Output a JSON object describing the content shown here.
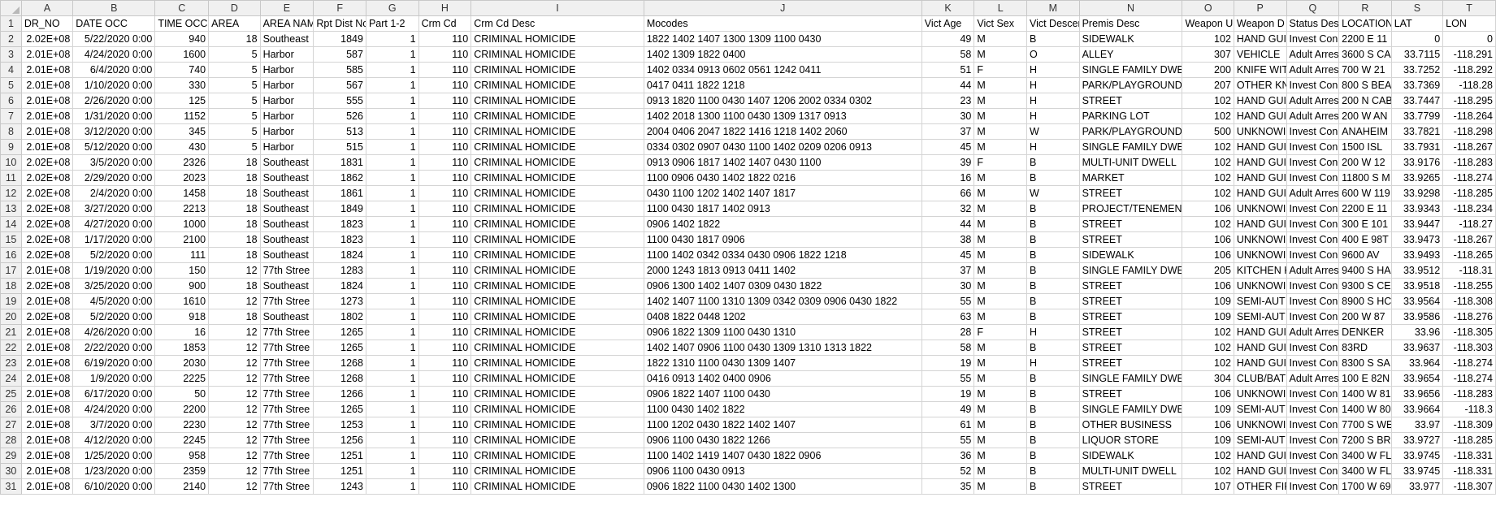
{
  "sheet": {
    "column_letters": [
      "A",
      "B",
      "C",
      "D",
      "E",
      "F",
      "G",
      "H",
      "I",
      "J",
      "K",
      "L",
      "M",
      "N",
      "O",
      "P",
      "Q",
      "R",
      "S",
      "T"
    ],
    "headers": [
      "DR_NO",
      "DATE OCC",
      "TIME OCC",
      "AREA",
      "AREA NAM",
      "Rpt Dist No",
      "Part 1-2",
      "Crm Cd",
      "Crm Cd Desc",
      "Mocodes",
      "Vict Age",
      "Vict Sex",
      "Vict Descent",
      "Premis Desc",
      "Weapon U",
      "Weapon D",
      "Status Des",
      "LOCATION",
      "LAT",
      "LON"
    ],
    "header_row_number": "1",
    "rows": [
      {
        "num": "2",
        "cells": [
          "2.02E+08",
          "5/22/2020 0:00",
          "940",
          "18",
          "Southeast",
          "1849",
          "1",
          "110",
          "CRIMINAL HOMICIDE",
          "1822 1402 1407 1300 1309 1100 0430",
          "49",
          "M",
          "B",
          "SIDEWALK",
          "102",
          "HAND GUI",
          "Invest Con",
          "2200 E 11",
          "0",
          "0"
        ]
      },
      {
        "num": "3",
        "cells": [
          "2.01E+08",
          "4/24/2020 0:00",
          "1600",
          "5",
          "Harbor",
          "587",
          "1",
          "110",
          "CRIMINAL HOMICIDE",
          "1402 1309 1822 0400",
          "58",
          "M",
          "O",
          "ALLEY",
          "307",
          "VEHICLE",
          "Adult Arres",
          "3600 S CA",
          "33.7115",
          "-118.291"
        ]
      },
      {
        "num": "4",
        "cells": [
          "2.01E+08",
          "6/4/2020 0:00",
          "740",
          "5",
          "Harbor",
          "585",
          "1",
          "110",
          "CRIMINAL HOMICIDE",
          "1402 0334 0913 0602 0561 1242 0411",
          "51",
          "F",
          "H",
          "SINGLE FAMILY DWE",
          "200",
          "KNIFE WIT",
          "Adult Arres",
          "700 W 21",
          "33.7252",
          "-118.292"
        ]
      },
      {
        "num": "5",
        "cells": [
          "2.01E+08",
          "1/10/2020 0:00",
          "330",
          "5",
          "Harbor",
          "567",
          "1",
          "110",
          "CRIMINAL HOMICIDE",
          "0417 0411 1822 1218",
          "44",
          "M",
          "H",
          "PARK/PLAYGROUND",
          "207",
          "OTHER KN",
          "Invest Con",
          "800 S BEA",
          "33.7369",
          "-118.28"
        ]
      },
      {
        "num": "6",
        "cells": [
          "2.01E+08",
          "2/26/2020 0:00",
          "125",
          "5",
          "Harbor",
          "555",
          "1",
          "110",
          "CRIMINAL HOMICIDE",
          "0913 1820 1100 0430 1407 1206 2002 0334 0302",
          "23",
          "M",
          "H",
          "STREET",
          "102",
          "HAND GUI",
          "Adult Arres",
          "200 N CAB",
          "33.7447",
          "-118.295"
        ]
      },
      {
        "num": "7",
        "cells": [
          "2.01E+08",
          "1/31/2020 0:00",
          "1152",
          "5",
          "Harbor",
          "526",
          "1",
          "110",
          "CRIMINAL HOMICIDE",
          "1402 2018 1300 1100 0430 1309 1317 0913",
          "30",
          "M",
          "H",
          "PARKING LOT",
          "102",
          "HAND GUI",
          "Adult Arres",
          "200 W AN",
          "33.7799",
          "-118.264"
        ]
      },
      {
        "num": "8",
        "cells": [
          "2.01E+08",
          "3/12/2020 0:00",
          "345",
          "5",
          "Harbor",
          "513",
          "1",
          "110",
          "CRIMINAL HOMICIDE",
          "2004 0406 2047 1822 1416 1218 1402 2060",
          "37",
          "M",
          "W",
          "PARK/PLAYGROUND",
          "500",
          "UNKNOWI",
          "Invest Con",
          "ANAHEIM",
          "33.7821",
          "-118.298"
        ]
      },
      {
        "num": "9",
        "cells": [
          "2.01E+08",
          "5/12/2020 0:00",
          "430",
          "5",
          "Harbor",
          "515",
          "1",
          "110",
          "CRIMINAL HOMICIDE",
          "0334 0302 0907 0430 1100 1402 0209 0206 0913",
          "45",
          "M",
          "H",
          "SINGLE FAMILY DWE",
          "102",
          "HAND GUI",
          "Invest Con",
          "1500 ISL",
          "33.7931",
          "-118.267"
        ]
      },
      {
        "num": "10",
        "cells": [
          "2.02E+08",
          "3/5/2020 0:00",
          "2326",
          "18",
          "Southeast",
          "1831",
          "1",
          "110",
          "CRIMINAL HOMICIDE",
          "0913 0906 1817 1402 1407 0430 1100",
          "39",
          "F",
          "B",
          "MULTI-UNIT DWELL",
          "102",
          "HAND GUI",
          "Invest Con",
          "200 W 12",
          "33.9176",
          "-118.283"
        ]
      },
      {
        "num": "11",
        "cells": [
          "2.02E+08",
          "2/29/2020 0:00",
          "2023",
          "18",
          "Southeast",
          "1862",
          "1",
          "110",
          "CRIMINAL HOMICIDE",
          "1100 0906 0430 1402 1822 0216",
          "16",
          "M",
          "B",
          "MARKET",
          "102",
          "HAND GUI",
          "Invest Con",
          "11800 S M",
          "33.9265",
          "-118.274"
        ]
      },
      {
        "num": "12",
        "cells": [
          "2.02E+08",
          "2/4/2020 0:00",
          "1458",
          "18",
          "Southeast",
          "1861",
          "1",
          "110",
          "CRIMINAL HOMICIDE",
          "0430 1100 1202 1402 1407 1817",
          "66",
          "M",
          "W",
          "STREET",
          "102",
          "HAND GUI",
          "Adult Arres",
          "600 W 119",
          "33.9298",
          "-118.285"
        ]
      },
      {
        "num": "13",
        "cells": [
          "2.02E+08",
          "3/27/2020 0:00",
          "2213",
          "18",
          "Southeast",
          "1849",
          "1",
          "110",
          "CRIMINAL HOMICIDE",
          "1100 0430 1817 1402 0913",
          "32",
          "M",
          "B",
          "PROJECT/TENEMENT",
          "106",
          "UNKNOWI",
          "Invest Con",
          "2200 E 11",
          "33.9343",
          "-118.234"
        ]
      },
      {
        "num": "14",
        "cells": [
          "2.02E+08",
          "4/27/2020 0:00",
          "1000",
          "18",
          "Southeast",
          "1823",
          "1",
          "110",
          "CRIMINAL HOMICIDE",
          "0906 1402 1822",
          "44",
          "M",
          "B",
          "STREET",
          "102",
          "HAND GUI",
          "Invest Con",
          "300 E 101",
          "33.9447",
          "-118.27"
        ]
      },
      {
        "num": "15",
        "cells": [
          "2.02E+08",
          "1/17/2020 0:00",
          "2100",
          "18",
          "Southeast",
          "1823",
          "1",
          "110",
          "CRIMINAL HOMICIDE",
          "1100 0430 1817 0906",
          "38",
          "M",
          "B",
          "STREET",
          "106",
          "UNKNOWI",
          "Invest Con",
          "400 E 98T",
          "33.9473",
          "-118.267"
        ]
      },
      {
        "num": "16",
        "cells": [
          "2.02E+08",
          "5/2/2020 0:00",
          "111",
          "18",
          "Southeast",
          "1824",
          "1",
          "110",
          "CRIMINAL HOMICIDE",
          "1100 1402 0342 0334 0430 0906 1822 1218",
          "45",
          "M",
          "B",
          "SIDEWALK",
          "106",
          "UNKNOWI",
          "Invest Con",
          "9600 AV",
          "33.9493",
          "-118.265"
        ]
      },
      {
        "num": "17",
        "cells": [
          "2.01E+08",
          "1/19/2020 0:00",
          "150",
          "12",
          "77th Stree",
          "1283",
          "1",
          "110",
          "CRIMINAL HOMICIDE",
          "2000 1243 1813 0913 0411 1402",
          "37",
          "M",
          "B",
          "SINGLE FAMILY DWE",
          "205",
          "KITCHEN K",
          "Adult Arres",
          "9400 S HA",
          "33.9512",
          "-118.31"
        ]
      },
      {
        "num": "18",
        "cells": [
          "2.02E+08",
          "3/25/2020 0:00",
          "900",
          "18",
          "Southeast",
          "1824",
          "1",
          "110",
          "CRIMINAL HOMICIDE",
          "0906 1300 1402 1407 0309 0430 1822",
          "30",
          "M",
          "B",
          "STREET",
          "106",
          "UNKNOWI",
          "Invest Con",
          "9300 S CE",
          "33.9518",
          "-118.255"
        ]
      },
      {
        "num": "19",
        "cells": [
          "2.01E+08",
          "4/5/2020 0:00",
          "1610",
          "12",
          "77th Stree",
          "1273",
          "1",
          "110",
          "CRIMINAL HOMICIDE",
          "1402 1407 1100 1310 1309 0342 0309 0906 0430 1822",
          "55",
          "M",
          "B",
          "STREET",
          "109",
          "SEMI-AUT",
          "Invest Con",
          "8900 S HC",
          "33.9564",
          "-118.308"
        ]
      },
      {
        "num": "20",
        "cells": [
          "2.02E+08",
          "5/2/2020 0:00",
          "918",
          "18",
          "Southeast",
          "1802",
          "1",
          "110",
          "CRIMINAL HOMICIDE",
          "0408 1822 0448 1202",
          "63",
          "M",
          "B",
          "STREET",
          "109",
          "SEMI-AUT",
          "Invest Con",
          "200 W 87",
          "33.9586",
          "-118.276"
        ]
      },
      {
        "num": "21",
        "cells": [
          "2.01E+08",
          "4/26/2020 0:00",
          "16",
          "12",
          "77th Stree",
          "1265",
          "1",
          "110",
          "CRIMINAL HOMICIDE",
          "0906 1822 1309 1100 0430 1310",
          "28",
          "F",
          "H",
          "STREET",
          "102",
          "HAND GUI",
          "Adult Arres",
          "DENKER",
          "33.96",
          "-118.305"
        ]
      },
      {
        "num": "22",
        "cells": [
          "2.01E+08",
          "2/22/2020 0:00",
          "1853",
          "12",
          "77th Stree",
          "1265",
          "1",
          "110",
          "CRIMINAL HOMICIDE",
          "1402 1407 0906 1100 0430 1309 1310 1313 1822",
          "58",
          "M",
          "B",
          "STREET",
          "102",
          "HAND GUI",
          "Invest Con",
          "83RD",
          "33.9637",
          "-118.303"
        ]
      },
      {
        "num": "23",
        "cells": [
          "2.01E+08",
          "6/19/2020 0:00",
          "2030",
          "12",
          "77th Stree",
          "1268",
          "1",
          "110",
          "CRIMINAL HOMICIDE",
          "1822 1310 1100 0430 1309 1407",
          "19",
          "M",
          "H",
          "STREET",
          "102",
          "HAND GUI",
          "Invest Con",
          "8300 S SA",
          "33.964",
          "-118.274"
        ]
      },
      {
        "num": "24",
        "cells": [
          "2.01E+08",
          "1/9/2020 0:00",
          "2225",
          "12",
          "77th Stree",
          "1268",
          "1",
          "110",
          "CRIMINAL HOMICIDE",
          "0416 0913 1402 0400 0906",
          "55",
          "M",
          "B",
          "SINGLE FAMILY DWE",
          "304",
          "CLUB/BAT",
          "Adult Arres",
          "100 E 82N",
          "33.9654",
          "-118.274"
        ]
      },
      {
        "num": "25",
        "cells": [
          "2.01E+08",
          "6/17/2020 0:00",
          "50",
          "12",
          "77th Stree",
          "1266",
          "1",
          "110",
          "CRIMINAL HOMICIDE",
          "0906 1822 1407 1100 0430",
          "19",
          "M",
          "B",
          "STREET",
          "106",
          "UNKNOWI",
          "Invest Con",
          "1400 W 81",
          "33.9656",
          "-118.283"
        ]
      },
      {
        "num": "26",
        "cells": [
          "2.01E+08",
          "4/24/2020 0:00",
          "2200",
          "12",
          "77th Stree",
          "1265",
          "1",
          "110",
          "CRIMINAL HOMICIDE",
          "1100 0430 1402 1822",
          "49",
          "M",
          "B",
          "SINGLE FAMILY DWE",
          "109",
          "SEMI-AUT",
          "Invest Con",
          "1400 W 80",
          "33.9664",
          "-118.3"
        ]
      },
      {
        "num": "27",
        "cells": [
          "2.01E+08",
          "3/7/2020 0:00",
          "2230",
          "12",
          "77th Stree",
          "1253",
          "1",
          "110",
          "CRIMINAL HOMICIDE",
          "1100 1202 0430 1822 1402 1407",
          "61",
          "M",
          "B",
          "OTHER BUSINESS",
          "106",
          "UNKNOWI",
          "Invest Con",
          "7700 S WE",
          "33.97",
          "-118.309"
        ]
      },
      {
        "num": "28",
        "cells": [
          "2.01E+08",
          "4/12/2020 0:00",
          "2245",
          "12",
          "77th Stree",
          "1256",
          "1",
          "110",
          "CRIMINAL HOMICIDE",
          "0906 1100 0430 1822 1266",
          "55",
          "M",
          "B",
          "LIQUOR STORE",
          "109",
          "SEMI-AUT",
          "Invest Con",
          "7200 S BR",
          "33.9727",
          "-118.285"
        ]
      },
      {
        "num": "29",
        "cells": [
          "2.01E+08",
          "1/25/2020 0:00",
          "958",
          "12",
          "77th Stree",
          "1251",
          "1",
          "110",
          "CRIMINAL HOMICIDE",
          "1100 1402 1419 1407 0430 1822 0906",
          "36",
          "M",
          "B",
          "SIDEWALK",
          "102",
          "HAND GUI",
          "Invest Con",
          "3400 W FL",
          "33.9745",
          "-118.331"
        ]
      },
      {
        "num": "30",
        "cells": [
          "2.01E+08",
          "1/23/2020 0:00",
          "2359",
          "12",
          "77th Stree",
          "1251",
          "1",
          "110",
          "CRIMINAL HOMICIDE",
          "0906 1100 0430 0913",
          "52",
          "M",
          "B",
          "MULTI-UNIT DWELL",
          "102",
          "HAND GUI",
          "Invest Con",
          "3400 W FL",
          "33.9745",
          "-118.331"
        ]
      },
      {
        "num": "31",
        "cells": [
          "2.01E+08",
          "6/10/2020 0:00",
          "2140",
          "12",
          "77th Stree",
          "1243",
          "1",
          "110",
          "CRIMINAL HOMICIDE",
          "0906 1822 1100 0430 1402 1300",
          "35",
          "M",
          "B",
          "STREET",
          "107",
          "OTHER FIR",
          "Invest Con",
          "1700 W 69",
          "33.977",
          "-118.307"
        ]
      }
    ]
  }
}
